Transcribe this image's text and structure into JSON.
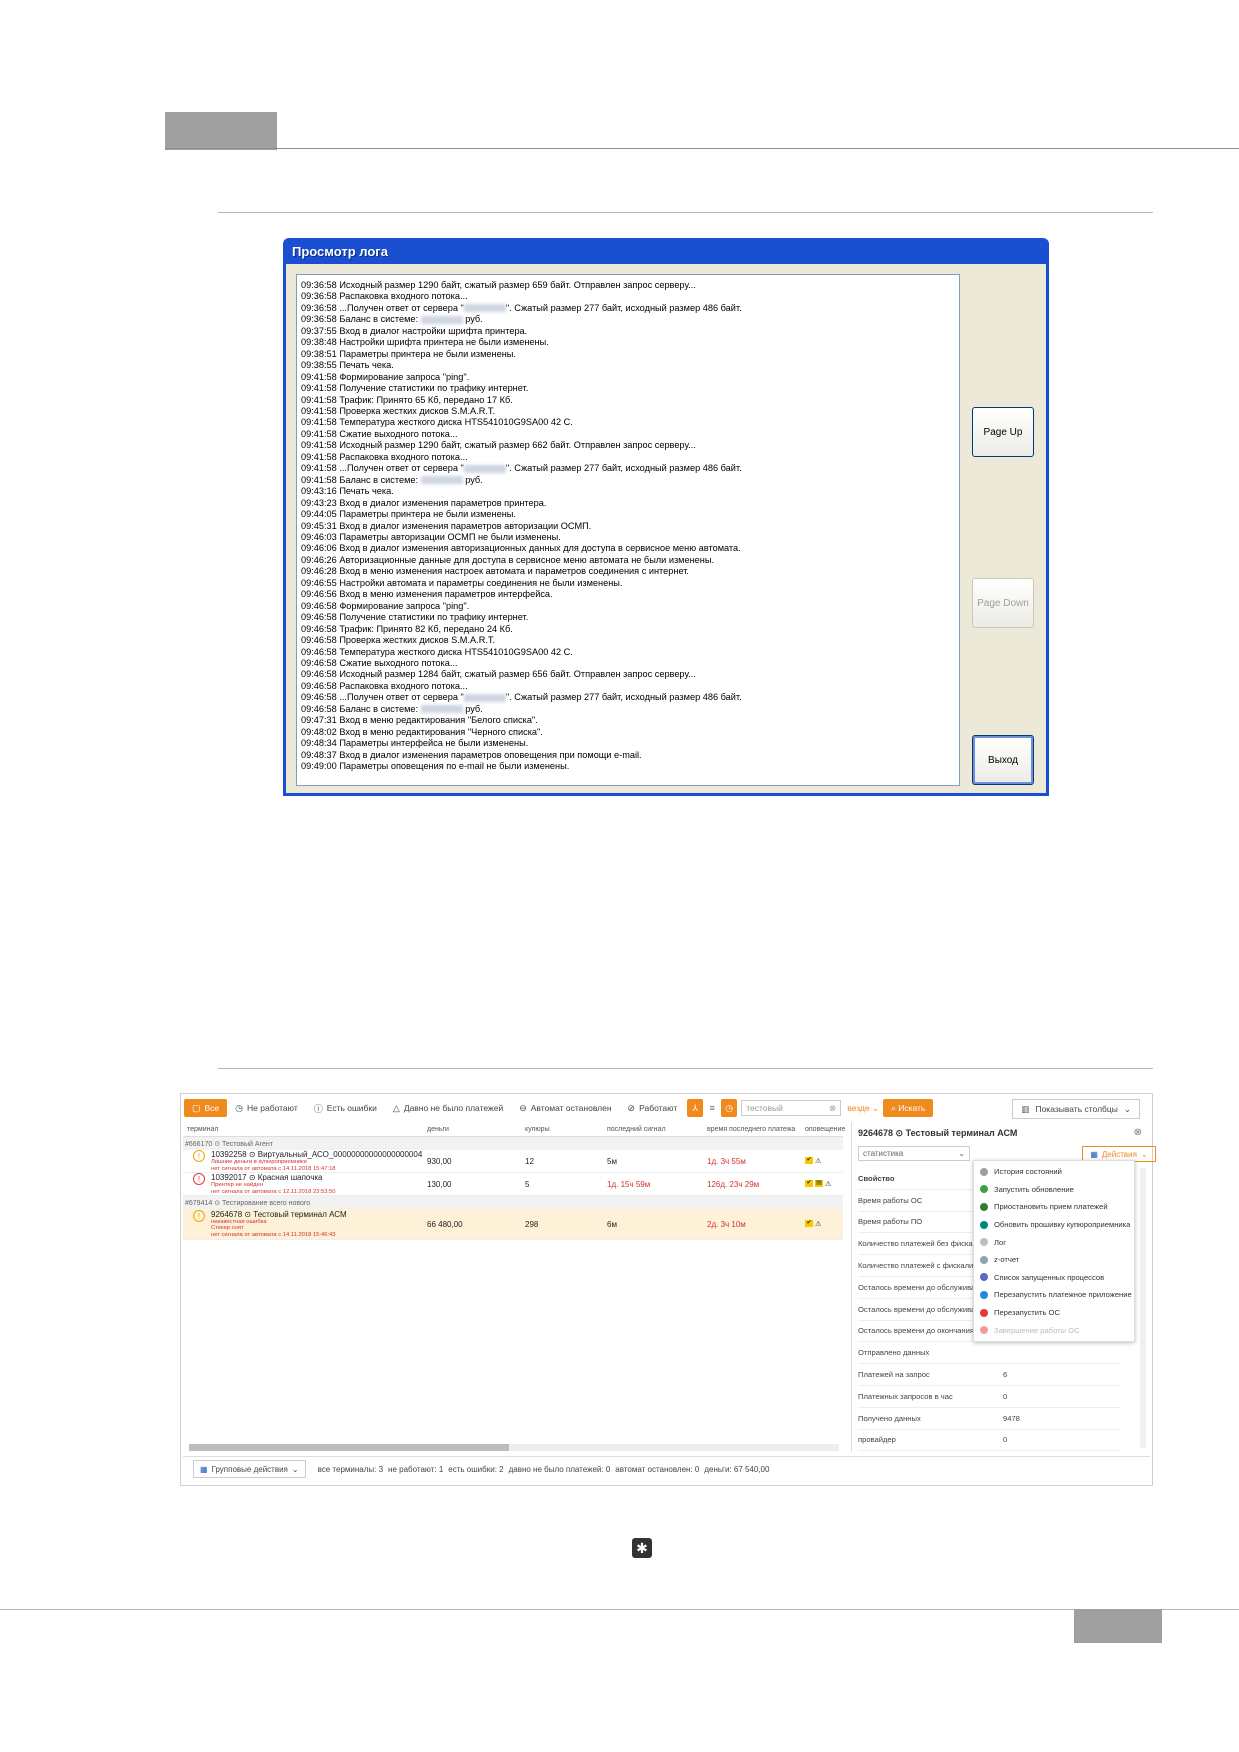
{
  "log_window": {
    "title": "Просмотр лога",
    "lines": [
      [
        "09:36:58 Исходный размер 1290 байт, сжатый размер 659 байт. Отправлен запрос серверу...",
        "",
        ""
      ],
      [
        "09:36:58 Распаковка входного потока...",
        "",
        ""
      ],
      [
        "09:36:58 ...Получен ответ от сервера \"",
        "blur",
        "\". Сжатый размер 277 байт, исходный размер 486 байт."
      ],
      [
        "09:36:58 Баланс в системе: ",
        "blur",
        " руб."
      ],
      [
        "09:37:55 Вход в диалог настройки шрифта принтера.",
        "",
        ""
      ],
      [
        "09:38:48 Настройки шрифта принтера не были изменены.",
        "",
        ""
      ],
      [
        "09:38:51 Параметры принтера не были изменены.",
        "",
        ""
      ],
      [
        "09:38:55 Печать чека.",
        "",
        ""
      ],
      [
        "09:41:58 Формирование запроса \"ping\".",
        "",
        ""
      ],
      [
        "09:41:58 Получение статистики по трафику интернет.",
        "",
        ""
      ],
      [
        "09:41:58 Трафик: Принято 65 Кб, передано 17 Кб.",
        "",
        ""
      ],
      [
        "09:41:58 Проверка жестких дисков S.M.A.R.T.",
        "",
        ""
      ],
      [
        "09:41:58 Температура жесткого диска HTS541010G9SA00 42 С.",
        "",
        ""
      ],
      [
        "09:41:58 Сжатие выходного потока...",
        "",
        ""
      ],
      [
        "09:41:58 Исходный размер 1290 байт, сжатый размер 662 байт. Отправлен запрос серверу...",
        "",
        ""
      ],
      [
        "09:41:58 Распаковка входного потока...",
        "",
        ""
      ],
      [
        "09:41:58 ...Получен ответ от сервера \"",
        "blur",
        "\". Сжатый размер 277 байт, исходный размер 486 байт."
      ],
      [
        "09:41:58 Баланс в системе: ",
        "blur",
        " руб."
      ],
      [
        "09:43:16 Печать чека.",
        "",
        ""
      ],
      [
        "09:43:23 Вход в диалог изменения параметров принтера.",
        "",
        ""
      ],
      [
        "09:44:05 Параметры принтера не были изменены.",
        "",
        ""
      ],
      [
        "09:45:31 Вход в диалог изменения параметров авторизации ОСМП.",
        "",
        ""
      ],
      [
        "09:46:03 Параметры авторизации ОСМП не были изменены.",
        "",
        ""
      ],
      [
        "09:46:06 Вход в диалог изменения авторизационных данных для доступа в сервисное меню автомата.",
        "",
        ""
      ],
      [
        "09:46:26 Авторизационные данные для доступа в сервисное меню автомата не были изменены.",
        "",
        ""
      ],
      [
        "09:46:28 Вход в меню изменения настроек автомата и параметров соединения с интернет.",
        "",
        ""
      ],
      [
        "09:46:55 Настройки автомата и параметры соединения не были изменены.",
        "",
        ""
      ],
      [
        "09:46:56 Вход в меню изменения параметров интерфейса.",
        "",
        ""
      ],
      [
        "09:46:58 Формирование запроса \"ping\".",
        "",
        ""
      ],
      [
        "09:46:58 Получение статистики по трафику интернет.",
        "",
        ""
      ],
      [
        "09:46:58 Трафик: Принято 82 Кб, передано 24 Кб.",
        "",
        ""
      ],
      [
        "09:46:58 Проверка жестких дисков S.M.A.R.T.",
        "",
        ""
      ],
      [
        "09:46:58 Температура жесткого диска HTS541010G9SA00 42 С.",
        "",
        ""
      ],
      [
        "09:46:58 Сжатие выходного потока...",
        "",
        ""
      ],
      [
        "09:46:58 Исходный размер 1284 байт, сжатый размер 656 байт. Отправлен запрос серверу...",
        "",
        ""
      ],
      [
        "09:46:58 Распаковка входного потока...",
        "",
        ""
      ],
      [
        "09:46:58 ...Получен ответ от сервера \"",
        "blur",
        "\". Сжатый размер 277 байт, исходный размер 486 байт."
      ],
      [
        "09:46:58 Баланс в системе: ",
        "blur",
        " руб."
      ],
      [
        "09:47:31 Вход в меню редактирования \"Белого списка\".",
        "",
        ""
      ],
      [
        "09:48:02 Вход в меню редактирования \"Черного списка\".",
        "",
        ""
      ],
      [
        "09:48:34 Параметры интерфейса не были изменены.",
        "",
        ""
      ],
      [
        "09:48:37 Вход в диалог изменения параметров оповещения при помощи e-mail.",
        "",
        ""
      ],
      [
        "09:49:00 Параметры оповещения по e-mail не были изменены.",
        "",
        ""
      ]
    ],
    "buttons": {
      "page_up": "Page Up",
      "page_down": "Page Down",
      "exit": "Выход"
    }
  },
  "web_ui": {
    "filters": [
      "Все",
      "Не работают",
      "Есть ошибки",
      "Давно не было платежей",
      "Автомат остановлен",
      "Работают"
    ],
    "search_placeholder": "тестовый",
    "search_scope": "везде",
    "search_button": "Искать",
    "columns_button": "Показывать столбцы",
    "grid_headers": [
      "терминал",
      "деньги",
      "купюры",
      "последний сигнал",
      "время последнего платежа",
      "оповещение"
    ],
    "groups": [
      {
        "title": "#666170 ⊙ Тестовый Агент",
        "rows": [
          {
            "terminal": "10392258 ⊙ Виртуальный_АСО_00000000000000000004",
            "sub1": "Лишние деньги в купюроприемнике",
            "sub2": "нет сигнала от автомата с 14.11.2018 15:47:18",
            "money": "930,00",
            "bills": "12",
            "last_signal": "5м",
            "last_payment": "1д. 3ч 55м",
            "status": "warn"
          },
          {
            "terminal": "10392017 ⊙ Красная шапочка",
            "sub1": "Принтер не найден",
            "sub2": "нет сигнала от автомата с 12.11.2018 23:53:50",
            "money": "130,00",
            "bills": "5",
            "last_signal": "1д. 15ч 59м",
            "last_payment": "126д. 23ч 29м",
            "status": "error"
          }
        ]
      },
      {
        "title": "#679414 ⊙ Тестирование всего нового",
        "rows": [
          {
            "terminal": "9264678 ⊙ Тестовый терминал АСМ",
            "sub1": "неизвестная ошибка",
            "sub2": "Стекер снят",
            "sub3": "нет сигнала от автомата с 14.11.2018 15:46:43",
            "money": "66 480,00",
            "bills": "298",
            "last_signal": "6м",
            "last_payment": "2д. 3ч 10м",
            "status": "warn"
          }
        ]
      }
    ],
    "details": {
      "title": "9264678 ⊙ Тестовый терминал АСМ",
      "select": "статистика",
      "actions_button": "Действия",
      "property_header": "Свойство",
      "properties": [
        {
          "k": "Время работы ОС",
          "v": ""
        },
        {
          "k": "Время работы ПО",
          "v": ""
        },
        {
          "k": "Количество платежей без фискализации",
          "v": ""
        },
        {
          "k": "Количество платежей с фискализацией",
          "v": ""
        },
        {
          "k": "Осталось времени до обслуживания",
          "v": ""
        },
        {
          "k": "Осталось времени до обслуживания",
          "v": ""
        },
        {
          "k": "Осталось времени до окончания",
          "v": ""
        },
        {
          "k": "Отправлено данных",
          "v": ""
        },
        {
          "k": "Платежей на запрос",
          "v": "6"
        },
        {
          "k": "Платежных запросов в час",
          "v": "0"
        },
        {
          "k": "Получено данных",
          "v": "9478"
        },
        {
          "k": "провайдер",
          "v": "0"
        }
      ],
      "menu": [
        {
          "label": "История состояний",
          "color": "#9e9e9e",
          "disabled": false
        },
        {
          "label": "Запустить обновление",
          "color": "#43a047",
          "disabled": false
        },
        {
          "label": "Приостановить прием платежей",
          "color": "#2e7d32",
          "disabled": false
        },
        {
          "label": "Обновить прошивку купюроприемника",
          "color": "#00897b",
          "disabled": false
        },
        {
          "label": "Лог",
          "color": "#bdbdbd",
          "disabled": false
        },
        {
          "label": "z-отчет",
          "color": "#90a4ae",
          "disabled": false
        },
        {
          "label": "Список запущенных процессов",
          "color": "#5c6bc0",
          "disabled": false
        },
        {
          "label": "Перезапустить платежное приложение",
          "color": "#1e88e5",
          "disabled": false
        },
        {
          "label": "Перезапустить ОС",
          "color": "#e53935",
          "disabled": false
        },
        {
          "label": "Завершение работы ОС",
          "color": "#e53935",
          "disabled": true
        }
      ]
    },
    "bottom": {
      "group_actions": "Групповые действия",
      "stats": [
        "все терминалы: 3",
        "не работают: 1",
        "есть ошибки: 2",
        "давно не было платежей: 0",
        "автомат остановлен: 0",
        "деньги: 67 540,00"
      ]
    }
  },
  "icons": {
    "gear_icon": "settings-gear-icon"
  }
}
